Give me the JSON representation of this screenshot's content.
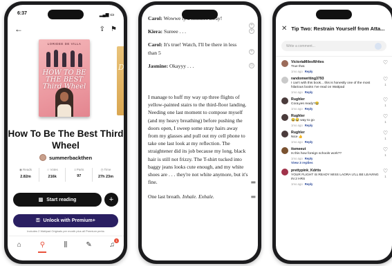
{
  "phone1": {
    "status_time": "6:37",
    "cover_author": "LORIDEE DE VILLA",
    "cover_title_lines": [
      "HOW TO BE",
      "THE BEST",
      "Third Wheel"
    ],
    "side_cover_letter": "D",
    "book_title": "How To Be The Best Third Wheel",
    "author": "summerbackthen",
    "stats": [
      {
        "label": "Reads",
        "value": "2.82m"
      },
      {
        "label": "Votes",
        "value": "216k"
      },
      {
        "label": "Parts",
        "value": "97"
      },
      {
        "label": "Time",
        "value": "27h 23m"
      }
    ],
    "start_reading": "Start reading",
    "plus": "+",
    "premium_button": "Unlock with Premium+",
    "premium_note": "Includes 2 Wattpad Originals per month plus all Premium perks",
    "notification_count": "1"
  },
  "phone2": {
    "dialogue": [
      {
        "speaker": "Carol:",
        "text": " Wowwe                ly 2 minutes away!"
      },
      {
        "speaker": "Kiera:",
        "text": " Sureee . . ."
      },
      {
        "speaker": "Carol:",
        "text": " It's true! Watch, I'll be there in less than 5"
      },
      {
        "speaker": "Jasmine:",
        "text": " Okayyy . . ."
      }
    ],
    "paragraph": "I manage to huff my way up three flights of yellow-painted stairs to the third-floor landing. Needing one last moment to compose myself (and my heavy breathing) before pushing the doors open, I sweep some stray hairs away from my glasses and pull out my cell phone to take one last look at my reflection. The straightener did its job because my long, black hair is still not frizzy. The T-shirt tucked into baggy jeans looks cute enough, and my white shoes are . . . they're not white anymore, but it's fine.",
    "last_line_plain": "One last breath. ",
    "last_line_italic": "Inhale. Exhale."
  },
  "phone3": {
    "title": "Tip Two: Restrain Yourself from Atta...",
    "input_placeholder": "Write a comment...",
    "reply_label": "Reply",
    "view_replies": "View 3 replies",
    "comments": [
      {
        "name": "VictoriaMilesWrites",
        "text": "True that.",
        "time": "1mo ago",
        "likes": "",
        "color": "#9b6b5a"
      },
      {
        "name": "randomwriting3793",
        "text": "I can't with this book... this is honestly one of the most hilarious books I've read on Wattpad",
        "time": "1mo ago",
        "likes": "1",
        "color": "#c9c9c9"
      },
      {
        "name": "Rughler",
        "text": "CooLyes ready?😂",
        "time": "1mo ago",
        "likes": "1",
        "color": "#4a3b3b"
      },
      {
        "name": "Rughler",
        "text": "😂😂 way to go",
        "time": "1mo ago",
        "likes": "1",
        "color": "#4a3b3b"
      },
      {
        "name": "Rughler",
        "text": "Nice 👍",
        "time": "1mo ago",
        "likes": "1",
        "color": "#4a3b3b"
      },
      {
        "name": "itsmeeut",
        "text": "Is this how foreign schools work??",
        "time": "1mo ago",
        "likes": "1",
        "color": "#7a5230"
      },
      {
        "name": "prettypink_Kdrtts",
        "text": "YOUR FLIGHT IS READY MISS LAORA U'LL BE LEAVING IN 2 HRS",
        "time": "1mo ago",
        "likes": "1",
        "color": "#a0324a"
      }
    ]
  }
}
